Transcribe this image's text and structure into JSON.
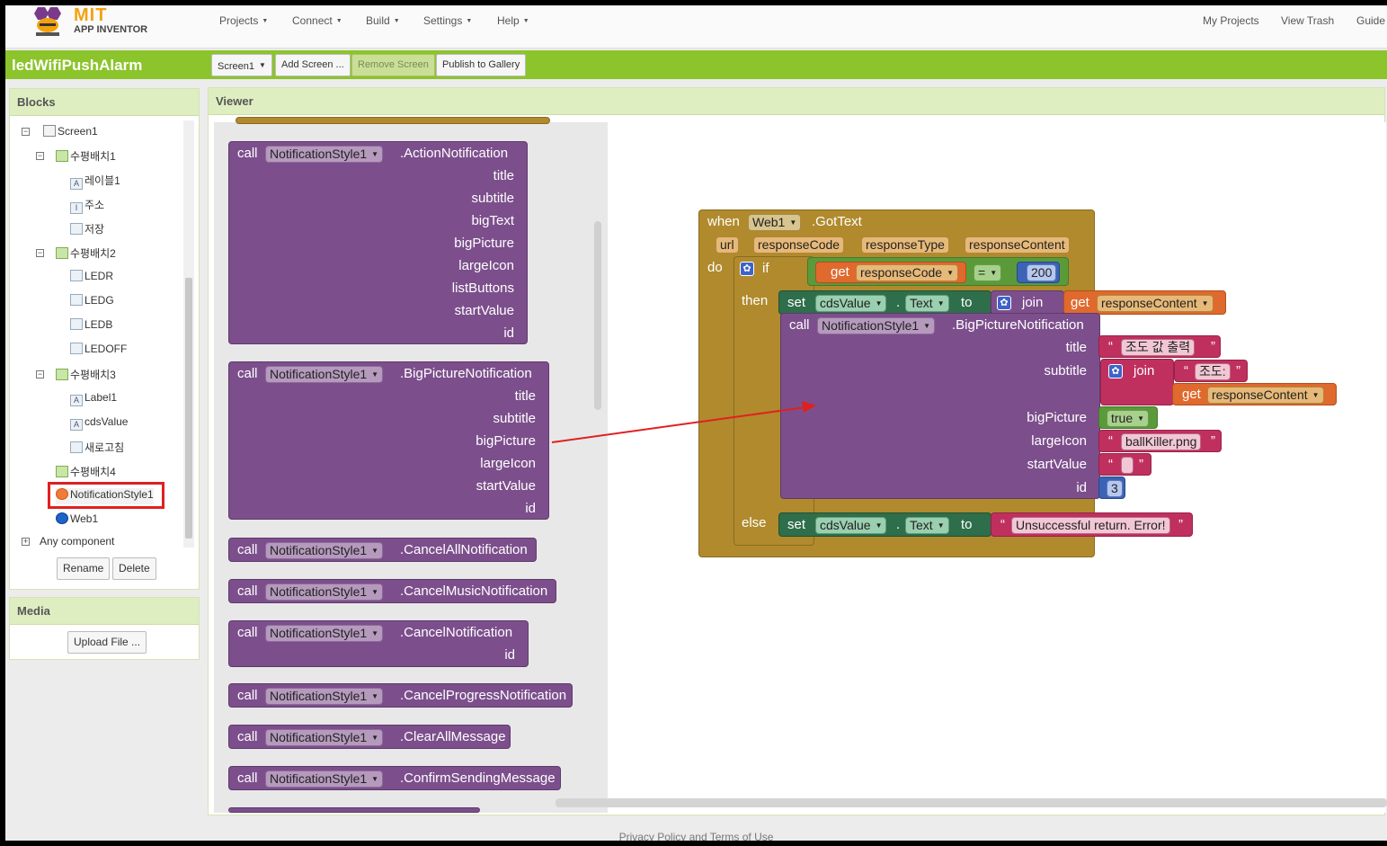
{
  "nav": {
    "logo_mit": "MIT",
    "logo_sub": "APP INVENTOR",
    "projects": "Projects",
    "connect": "Connect",
    "build": "Build",
    "settings": "Settings",
    "help": "Help",
    "my_projects": "My Projects",
    "view_trash": "View Trash",
    "guide": "Guide"
  },
  "project": {
    "name": "ledWifiPushAlarm",
    "screen_select": "Screen1",
    "add_screen": "Add Screen ...",
    "remove_screen": "Remove Screen",
    "publish": "Publish to Gallery"
  },
  "blocks_panel": {
    "title": "Blocks",
    "tree": [
      {
        "label": "Screen1",
        "icon": "screen-icon",
        "toggle": "⊟"
      },
      {
        "label": "수평배치1",
        "icon": "horizontal-arrangement-icon",
        "toggle": "⊟"
      },
      {
        "label": "레이블1",
        "icon": "label-icon"
      },
      {
        "label": "주소",
        "icon": "textbox-icon"
      },
      {
        "label": "저장",
        "icon": "button-icon"
      },
      {
        "label": "수평배치2",
        "icon": "horizontal-arrangement-icon",
        "toggle": "⊟"
      },
      {
        "label": "LEDR",
        "icon": "button-icon"
      },
      {
        "label": "LEDG",
        "icon": "button-icon"
      },
      {
        "label": "LEDB",
        "icon": "button-icon"
      },
      {
        "label": "LEDOFF",
        "icon": "button-icon"
      },
      {
        "label": "수평배치3",
        "icon": "horizontal-arrangement-icon",
        "toggle": "⊟"
      },
      {
        "label": "Label1",
        "icon": "label-icon"
      },
      {
        "label": "cdsValue",
        "icon": "label-icon"
      },
      {
        "label": "새로고침",
        "icon": "button-icon"
      },
      {
        "label": "수평배치4",
        "icon": "horizontal-arrangement-icon"
      },
      {
        "label": "NotificationStyle1",
        "icon": "notification-icon"
      },
      {
        "label": "Web1",
        "icon": "web-icon"
      },
      {
        "label": "Any component",
        "toggle": "⊞"
      }
    ],
    "rename": "Rename",
    "delete": "Delete"
  },
  "media_panel": {
    "title": "Media",
    "upload": "Upload File ..."
  },
  "viewer": {
    "title": "Viewer",
    "flyout": [
      {
        "call": "call",
        "component": "NotificationStyle1",
        "method": ".ActionNotification",
        "params": [
          "title",
          "subtitle",
          "bigText",
          "bigPicture",
          "largeIcon",
          "listButtons",
          "startValue",
          "id"
        ]
      },
      {
        "call": "call",
        "component": "NotificationStyle1",
        "method": ".BigPictureNotification",
        "params": [
          "title",
          "subtitle",
          "bigPicture",
          "largeIcon",
          "startValue",
          "id"
        ]
      },
      {
        "call": "call",
        "component": "NotificationStyle1",
        "method": ".CancelAllNotification",
        "params": []
      },
      {
        "call": "call",
        "component": "NotificationStyle1",
        "method": ".CancelMusicNotification",
        "params": []
      },
      {
        "call": "call",
        "component": "NotificationStyle1",
        "method": ".CancelNotification",
        "params": [
          "id"
        ]
      },
      {
        "call": "call",
        "component": "NotificationStyle1",
        "method": ".CancelProgressNotification",
        "params": []
      },
      {
        "call": "call",
        "component": "NotificationStyle1",
        "method": ".ClearAllMessage",
        "params": []
      },
      {
        "call": "call",
        "component": "NotificationStyle1",
        "method": ".ConfirmSendingMessage",
        "params": []
      }
    ],
    "event": {
      "when": "when",
      "component": "Web1",
      "event": ".GotText",
      "params": [
        "url",
        "responseCode",
        "responseType",
        "responseContent"
      ],
      "do": "do",
      "if": "if",
      "then": "then",
      "else": "else",
      "get": "get",
      "cond_var": "responseCode",
      "op": "=",
      "cond_val": "200",
      "set": "set",
      "set_target": "cdsValue",
      "set_prop": "Text",
      "to": "to",
      "join": "join",
      "content_var": "responseContent",
      "call": "call",
      "call_component": "NotificationStyle1",
      "call_method": ".BigPictureNotification",
      "args": {
        "title_label": "title",
        "title_val": "조도 값 출력",
        "subtitle_label": "subtitle",
        "subtitle_text": "조도:",
        "bigpicture_label": "bigPicture",
        "bigpicture_val": "true",
        "largeicon_label": "largeIcon",
        "largeicon_val": "ballKiller.png",
        "startvalue_label": "startValue",
        "id_label": "id",
        "id_val": "3"
      },
      "else_text": "Unsuccessful return. Error!"
    }
  },
  "footer": "Privacy Policy and Terms of Use"
}
